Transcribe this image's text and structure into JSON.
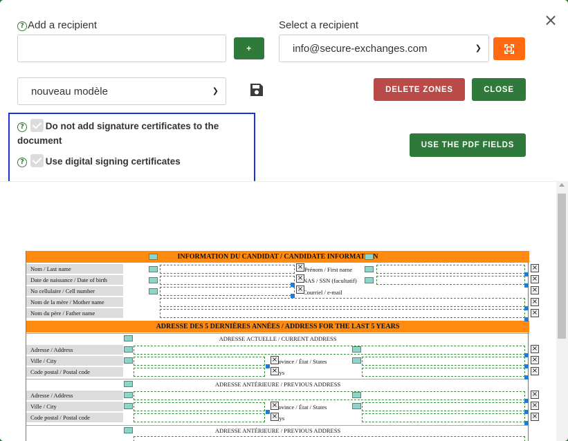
{
  "dialog": {
    "add_recipient": {
      "label": "Add a recipient",
      "value": "",
      "add_button": "+"
    },
    "select_recipient": {
      "label": "Select a recipient",
      "selected": "info@secure-exchanges.com"
    },
    "template": {
      "selected": "nouveau modèle"
    },
    "buttons": {
      "delete_zones": "DELETE ZONES",
      "close": "CLOSE",
      "use_pdf_fields": "USE THE PDF FIELDS"
    },
    "options": [
      {
        "label": "Do not add signature certificates to the document",
        "checked": true
      },
      {
        "label": "Use digital signing certificates",
        "checked": true
      }
    ],
    "icons": {
      "help": "question-circle-icon",
      "save": "floppy-disk-icon",
      "expand": "expand-icon",
      "close": "close-icon",
      "remove": "x-icon"
    },
    "colors": {
      "green": "#2f7a3b",
      "red": "#b94a48",
      "orange": "#ff6a13",
      "highlight": "#1d2fd8",
      "pdf_header": "#ff8a10"
    }
  },
  "pdf": {
    "section1_title": "INFORMATION DU CANDIDAT / CANDIDATE INFORMATION",
    "section1_rows": [
      "Nom / Last name",
      "Date de naissance / Date of birth",
      "No cellulaire / Cell number",
      "Nom de la mère / Mother name",
      "Nom du père / Father name"
    ],
    "section1_right": [
      "Prénom / First name",
      "NAS / SSN (facultatif)",
      "Courriel / e-mail"
    ],
    "section2_title": "ADRESSE DES 5 DERNIÈRES ANNÉES / ADDRESS FOR THE LAST 5 YEARS",
    "current_address": "ADRESSE ACTUELLE / CURRENT ADDRESS",
    "previous_address": "ADRESSE ANTÉRIEURE / PREVIOUS ADDRESS",
    "address_rows": [
      "Adresse / Address",
      "Ville / City",
      "Code postal / Postal code"
    ],
    "address_right": [
      "Province / État / States",
      "Pays"
    ]
  }
}
